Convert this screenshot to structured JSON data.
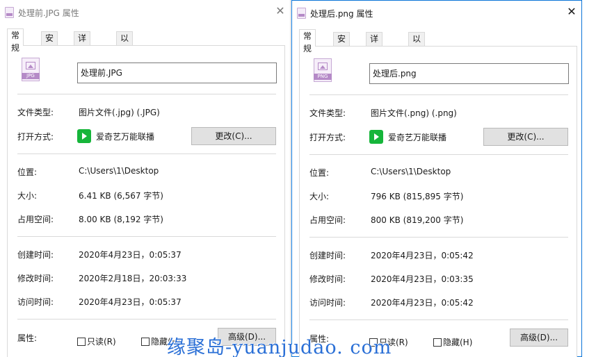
{
  "left": {
    "title": "处理前.JPG 属性",
    "tabs": [
      "常规",
      "安全",
      "详细信息",
      "以前的版本"
    ],
    "icon_ext": "JPG",
    "file_name": "处理前.JPG",
    "labels": {
      "type": "文件类型:",
      "opens_with": "打开方式:",
      "location": "位置:",
      "size": "大小:",
      "size_on_disk": "占用空间:",
      "created": "创建时间:",
      "modified": "修改时间:",
      "accessed": "访问时间:",
      "attributes": "属性:"
    },
    "values": {
      "type": "图片文件(.jpg) (.JPG)",
      "opens_with": "爱奇艺万能联播",
      "location": "C:\\Users\\1\\Desktop",
      "size": "6.41 KB (6,567 字节)",
      "size_on_disk": "8.00 KB (8,192 字节)",
      "created": "2020年4月23日，0:05:37",
      "modified": "2020年2月18日，20:03:33",
      "accessed": "2020年4月23日，0:05:37"
    },
    "change_button": "更改(C)...",
    "readonly": "只读(R)",
    "hidden": "隐藏(H)",
    "advanced_button": "高级(D)..."
  },
  "right": {
    "title": "处理后.png 属性",
    "tabs": [
      "常规",
      "安全",
      "详细信息",
      "以前的版本"
    ],
    "icon_ext": "PNG",
    "file_name": "处理后.png",
    "labels": {
      "type": "文件类型:",
      "opens_with": "打开方式:",
      "location": "位置:",
      "size": "大小:",
      "size_on_disk": "占用空间:",
      "created": "创建时间:",
      "modified": "修改时间:",
      "accessed": "访问时间:",
      "attributes": "属性:"
    },
    "values": {
      "type": "图片文件(.png) (.png)",
      "opens_with": "爱奇艺万能联播",
      "location": "C:\\Users\\1\\Desktop",
      "size": "796 KB (815,895 字节)",
      "size_on_disk": "800 KB (819,200 字节)",
      "created": "2020年4月23日，0:05:42",
      "modified": "2020年4月23日，0:03:35",
      "accessed": "2020年4月23日，0:05:42"
    },
    "change_button": "更改(C)...",
    "readonly": "只读(R)",
    "hidden": "隐藏(H)",
    "advanced_button": "高级(D)..."
  },
  "close_symbol": "✕",
  "watermark": "缘聚岛-yuanjudao. com",
  "colors": {
    "active_border": "#0a74d8",
    "button_bg": "#e1e1e1",
    "app_icon": "#16b53a",
    "file_icon": "#b58ac7",
    "watermark": "#2a6fd6"
  }
}
